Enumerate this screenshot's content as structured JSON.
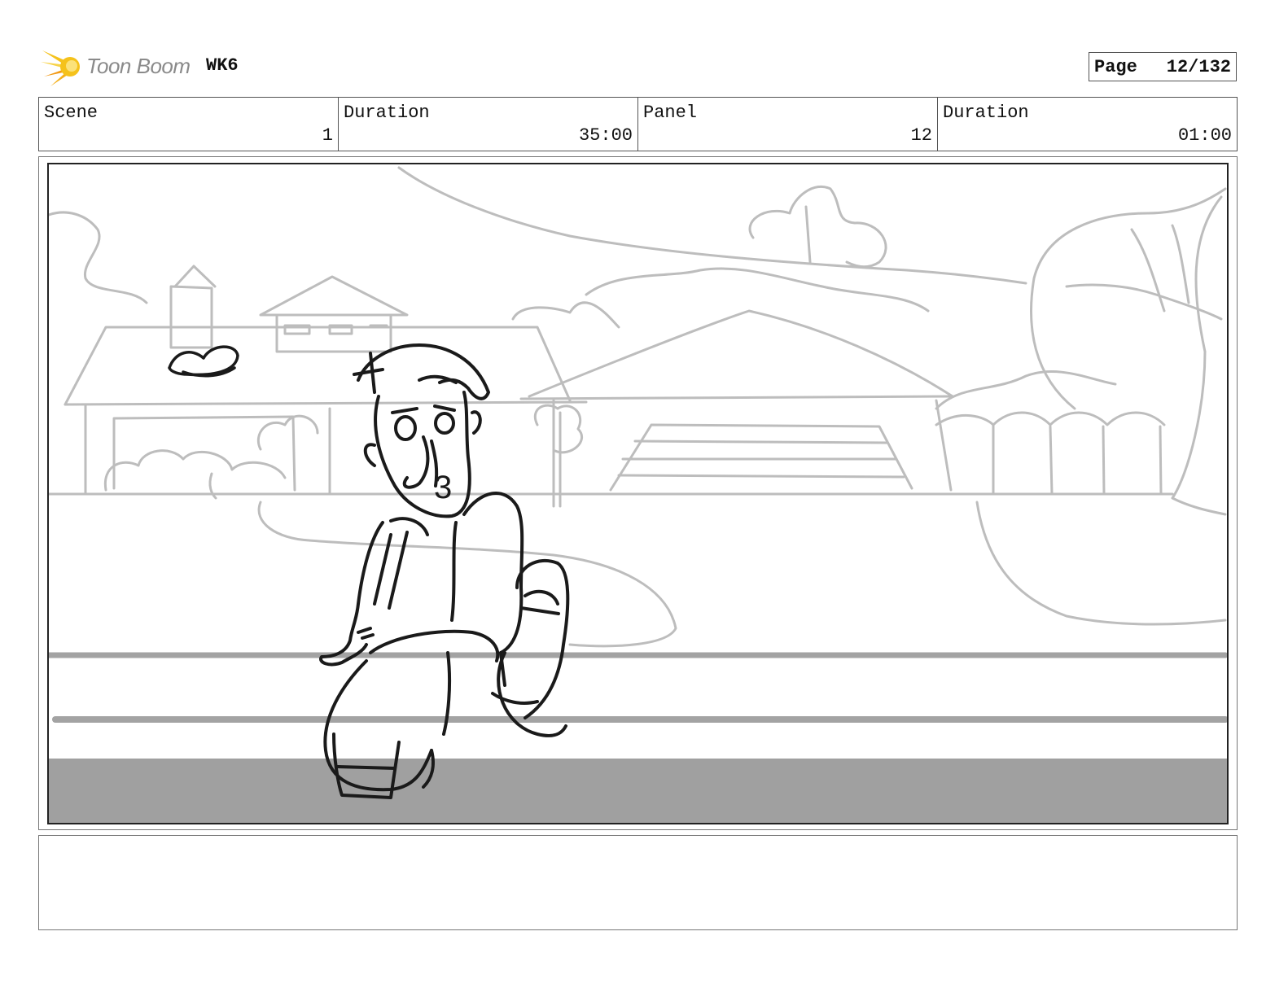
{
  "header": {
    "brand": "Toon Boom",
    "project": "WK6",
    "page_label": "Page",
    "page_value": "12/132"
  },
  "info": {
    "scene_label": "Scene",
    "scene_value": "1",
    "scene_duration_label": "Duration",
    "scene_duration_value": "35:00",
    "panel_label": "Panel",
    "panel_value": "12",
    "panel_duration_label": "Duration",
    "panel_duration_value": "01:00"
  },
  "drawing": {
    "shirt_number": "3"
  },
  "colors": {
    "logo_yellow": "#f5c21b",
    "logo_orange": "#f29a16",
    "sketch_light": "#bdbdbd",
    "sketch_dark": "#1a1a1a",
    "ground_gray": "#a0a0a0"
  }
}
